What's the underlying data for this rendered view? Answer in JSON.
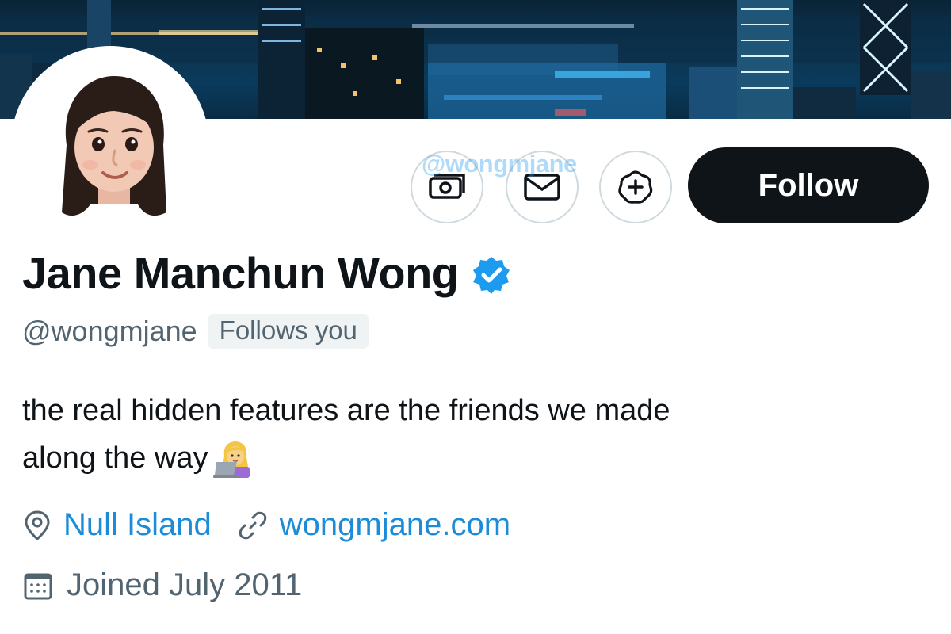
{
  "profile": {
    "display_name": "Jane Manchun Wong",
    "handle": "@wongmjane",
    "follows_you": "Follows you",
    "bio_line_1": "the real hidden features are the friends we made",
    "bio_line_2": "along the way",
    "bio_emoji": "woman-technologist-emoji",
    "location": "Null Island",
    "website": "wongmjane.com",
    "joined": "Joined July 2011",
    "verified_icon": "verified-badge-icon",
    "avatar": "memoji-avatar"
  },
  "actions": {
    "tip_icon": "money-icon",
    "message_icon": "envelope-icon",
    "subscribe_icon": "notification-plus-icon",
    "follow_label": "Follow"
  },
  "watermark": "@wongmjane",
  "colors": {
    "accent": "#1d9bf0",
    "link": "#1d8cd8",
    "text_primary": "#0f1419",
    "text_secondary": "#536471",
    "follow_bg": "#0f1419",
    "badge_bg": "#eff3f4"
  }
}
